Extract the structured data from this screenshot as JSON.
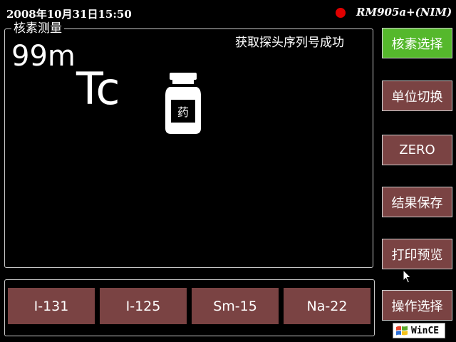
{
  "header": {
    "datetime": "2008年10月31日15:50",
    "status_color": "#e00000",
    "device_name": "RM905a+(NIM)"
  },
  "measurement": {
    "title": "核素测量",
    "message": "获取探头序列号成功",
    "mass_number": "99m",
    "symbol": "Tc",
    "bottle_label": "药",
    "icon": "medicine-bottle-icon"
  },
  "isotopes": [
    "I-131",
    "I-125",
    "Sm-15",
    "Na-22"
  ],
  "side_buttons": {
    "nuclide_select": "核素选择",
    "unit_switch": "单位切换",
    "zero": "ZERO",
    "save_result": "结果保存",
    "print_preview": "打印预览",
    "operation_select": "操作选择"
  },
  "colors": {
    "button": "#7a4343",
    "active_button": "#55b82c"
  },
  "taskbar": {
    "logo_text": "WinCE"
  }
}
